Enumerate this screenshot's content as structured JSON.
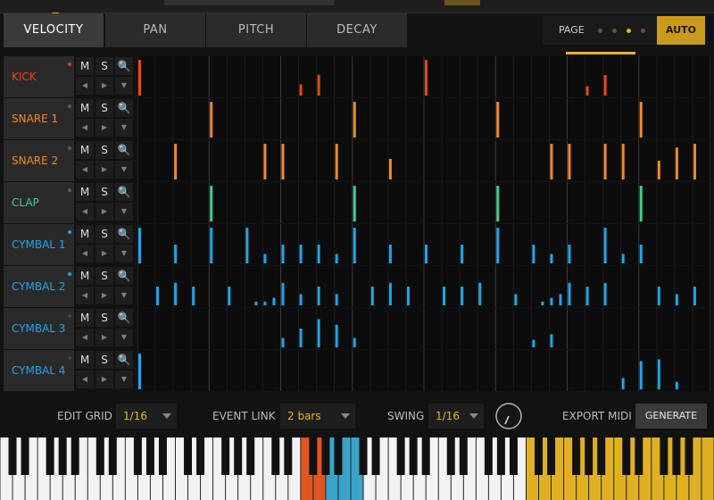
{
  "tabs": [
    "VELOCITY",
    "PAN",
    "PITCH",
    "DECAY"
  ],
  "active_tab": 0,
  "page": {
    "label": "PAGE",
    "dots": [
      false,
      false,
      true,
      false
    ]
  },
  "auto_label": "AUTO",
  "controls": {
    "mute": "M",
    "solo": "S",
    "search": "🔍",
    "left": "◀",
    "right": "▶",
    "down": "▼"
  },
  "lanes": [
    {
      "name": "KICK",
      "color": "#e8471a",
      "dot": "#e03a2e",
      "notes": [
        [
          0,
          0.95
        ],
        [
          9,
          0.3
        ],
        [
          10,
          0.55
        ],
        [
          16,
          0.95
        ],
        [
          25,
          0.25
        ],
        [
          26,
          0.55
        ]
      ]
    },
    {
      "name": "SNARE 1",
      "color": "#f08a2a",
      "dot": "#6a5a3a",
      "notes": [
        [
          4,
          0.95
        ],
        [
          12,
          0.95
        ],
        [
          20,
          0.95
        ],
        [
          28,
          0.95
        ]
      ]
    },
    {
      "name": "SNARE 2",
      "color": "#f08a2a",
      "dot": "#6a5a3a",
      "notes": [
        [
          2,
          0.95
        ],
        [
          7,
          0.95
        ],
        [
          8,
          0.95
        ],
        [
          11,
          0.95
        ],
        [
          14,
          0.55
        ],
        [
          23,
          0.95
        ],
        [
          24,
          0.95
        ],
        [
          26,
          0.95
        ],
        [
          27,
          0.95
        ],
        [
          29,
          0.5
        ],
        [
          30,
          0.85
        ],
        [
          31,
          0.95
        ]
      ]
    },
    {
      "name": "CLAP",
      "color": "#3fcf8e",
      "dot": "#3a6a5a",
      "notes": [
        [
          4,
          0.95
        ],
        [
          12,
          0.95
        ],
        [
          20,
          0.95
        ],
        [
          28,
          0.95
        ]
      ]
    },
    {
      "name": "CYMBAL 1",
      "color": "#1ea7e8",
      "dot": "#1ea7e8",
      "notes": [
        [
          0,
          0.95
        ],
        [
          2,
          0.5
        ],
        [
          4,
          0.95
        ],
        [
          6,
          0.95
        ],
        [
          7,
          0.25
        ],
        [
          8,
          0.5
        ],
        [
          9,
          0.5
        ],
        [
          10,
          0.5
        ],
        [
          11,
          0.25
        ],
        [
          12,
          0.95
        ],
        [
          14,
          0.5
        ],
        [
          16,
          0.5
        ],
        [
          18,
          0.5
        ],
        [
          20,
          0.95
        ],
        [
          22,
          0.5
        ],
        [
          23,
          0.25
        ],
        [
          24,
          0.5
        ],
        [
          26,
          0.95
        ],
        [
          27,
          0.25
        ],
        [
          28,
          0.5
        ]
      ]
    },
    {
      "name": "CYMBAL 2",
      "color": "#1ea7e8",
      "dot": "#1ea7e8",
      "notes": [
        [
          1,
          0.5
        ],
        [
          2,
          0.6
        ],
        [
          3,
          0.5
        ],
        [
          5,
          0.5
        ],
        [
          6.5,
          0.1
        ],
        [
          7,
          0.1
        ],
        [
          7.5,
          0.2
        ],
        [
          8,
          0.6
        ],
        [
          9,
          0.3
        ],
        [
          10,
          0.5
        ],
        [
          11,
          0.3
        ],
        [
          13,
          0.5
        ],
        [
          14,
          0.6
        ],
        [
          15,
          0.5
        ],
        [
          17,
          0.5
        ],
        [
          18,
          0.5
        ],
        [
          19,
          0.6
        ],
        [
          21,
          0.3
        ],
        [
          22.5,
          0.1
        ],
        [
          23,
          0.2
        ],
        [
          23.5,
          0.3
        ],
        [
          24,
          0.6
        ],
        [
          25,
          0.5
        ],
        [
          26,
          0.6
        ],
        [
          29,
          0.5
        ],
        [
          30,
          0.3
        ],
        [
          31,
          0.5
        ]
      ]
    },
    {
      "name": "CYMBAL 3",
      "color": "#1ea7e8",
      "dot": "#2a4a5a",
      "notes": [
        [
          8,
          0.25
        ],
        [
          9,
          0.5
        ],
        [
          10,
          0.75
        ],
        [
          11,
          0.6
        ],
        [
          12,
          0.25
        ],
        [
          22,
          0.2
        ],
        [
          23,
          0.35
        ]
      ]
    },
    {
      "name": "CYMBAL 4",
      "color": "#1ea7e8",
      "dot": "#2a4a5a",
      "notes": [
        [
          0,
          0.95
        ],
        [
          27,
          0.3
        ],
        [
          28,
          0.75
        ],
        [
          29,
          0.8
        ],
        [
          30,
          0.2
        ]
      ]
    }
  ],
  "bottom": {
    "edit_grid_label": "EDIT GRID",
    "edit_grid_value": "1/16",
    "event_link_label": "EVENT LINK",
    "event_link_value": "2 bars",
    "swing_label": "SWING",
    "swing_value": "1/16",
    "export_midi_label": "EXPORT MIDI",
    "generate_label": "GENERATE"
  },
  "keyboard": {
    "orange_keys": [
      24,
      25
    ],
    "blue_keys": [
      26,
      27,
      28
    ],
    "gold_keys": [
      42,
      43,
      44,
      45,
      46,
      47,
      48,
      49,
      50,
      51,
      52,
      53,
      54,
      55,
      56,
      57
    ]
  }
}
